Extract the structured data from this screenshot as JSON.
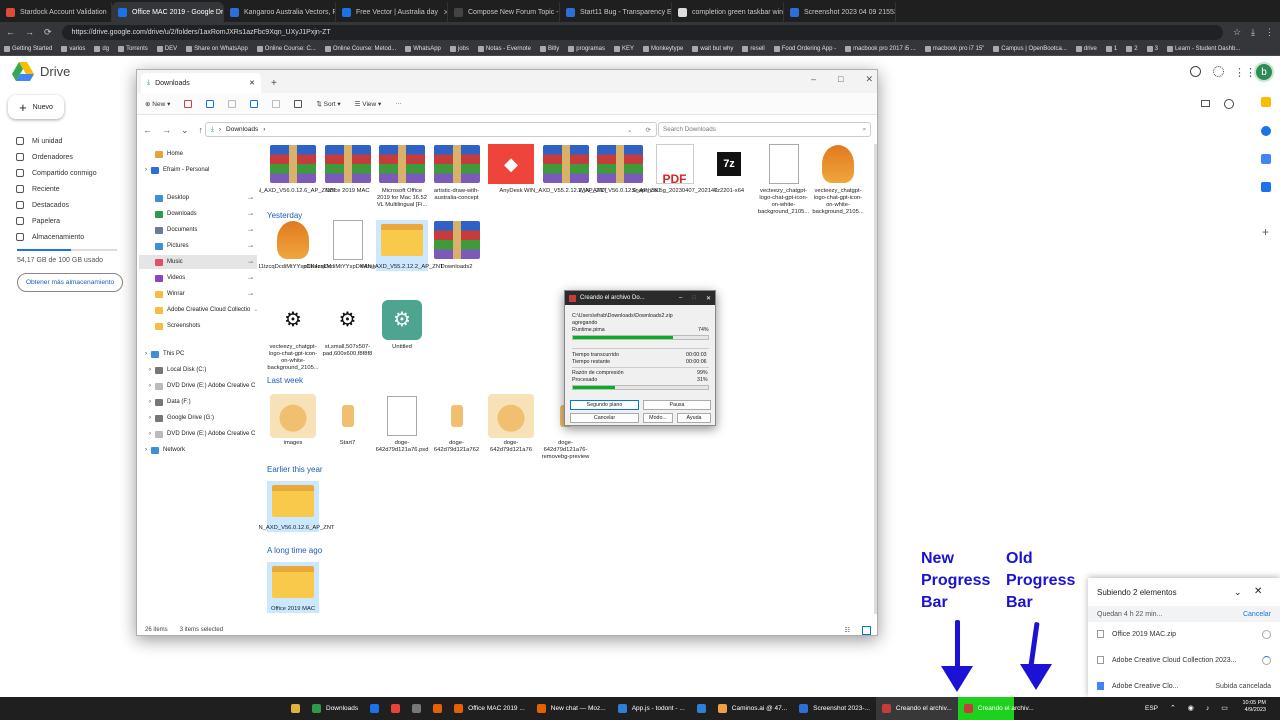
{
  "browser": {
    "tabs": [
      {
        "title": "Stardock Account Validation",
        "color": "#e04a3a"
      },
      {
        "title": "Office MAC 2019 - Google Drive",
        "color": "#1a73e8",
        "active": true
      },
      {
        "title": "Kangaroo Australia Vectors, Ph",
        "color": "#2d6fd8"
      },
      {
        "title": "Free Vector | Australia day",
        "color": "#1a73e8"
      },
      {
        "title": "Compose New Forum Topic -",
        "color": "#444"
      },
      {
        "title": "Start11 Bug - Transparency Eff",
        "color": "#2d6fd8"
      },
      {
        "title": "completion green taskbar wind",
        "color": "#ddd"
      },
      {
        "title": "Screenshot 2023 04 09 215536",
        "color": "#2d6fd8"
      }
    ],
    "url": "https://drive.google.com/drive/u/2/folders/1axRomJXRs1azFbc9Xqn_UXyJ1Pxjn-ZT",
    "bookmarks": [
      "Getting Started",
      "varios",
      "dg",
      "Torrents",
      "DEV",
      "Share on WhatsApp",
      "Online Course: C...",
      "Online Course: Metod...",
      "WhatsApp",
      "jobs",
      "Notas - Evernote",
      "Bitly",
      "programas",
      "KEY",
      "Monkeytype",
      "wait but why",
      "resell",
      "Food Ordering App -",
      "macbook pro 2017 i5 ...",
      "macbook pro i7 15\"",
      "Campus | OpenBootca...",
      "drive",
      "1",
      "2",
      "3",
      "Learn - Student Dashb..."
    ]
  },
  "drive": {
    "logo": "Drive",
    "new_button": "Nuevo",
    "nav": [
      "Mi unidad",
      "Ordenadores",
      "Compartido conmigo",
      "Reciente",
      "Destacados",
      "Papelera",
      "Almacenamiento"
    ],
    "storage_text": "54,17 GB de 100 GB usado",
    "storage_used_fraction": 0.54,
    "get_storage": "Obtener más almacenamiento",
    "avatar": "b"
  },
  "explorer": {
    "tab_title": "Downloads",
    "commands": [
      "New",
      "Sort",
      "View"
    ],
    "breadcrumb": "Downloads",
    "search_placeholder": "Search Downloads",
    "nav": [
      {
        "label": "Home",
        "color": "#e8a33c"
      },
      {
        "label": "Efraim - Personal",
        "color": "#2d6fd8"
      },
      {
        "label": "Desktop",
        "color": "#3d8fd8",
        "pin": true
      },
      {
        "label": "Downloads",
        "color": "#2d9a4a",
        "pin": true
      },
      {
        "label": "Documents",
        "color": "#6c7b95",
        "pin": true
      },
      {
        "label": "Pictures",
        "color": "#3d8fd8",
        "pin": true
      },
      {
        "label": "Music",
        "color": "#e0506b",
        "pin": true,
        "selected": true
      },
      {
        "label": "Videos",
        "color": "#8b45c4",
        "pin": true
      },
      {
        "label": "Winrar",
        "color": "#f0c040",
        "pin": true
      },
      {
        "label": "Adobe Creative Cloud Collectio",
        "color": "#f0c040",
        "pin": true
      },
      {
        "label": "Screenshots",
        "color": "#f0c040"
      },
      {
        "label": "This PC",
        "color": "#3d8fd8"
      },
      {
        "label": "Local Disk (C:)",
        "color": "#777"
      },
      {
        "label": "DVD Drive (E:) Adobe Creative C",
        "color": "#bbb"
      },
      {
        "label": "Data (F:)",
        "color": "#777"
      },
      {
        "label": "Google Drive (G:)",
        "color": "#777"
      },
      {
        "label": "DVD Drive (E:) Adobe Creative C",
        "color": "#bbb"
      },
      {
        "label": "Network",
        "color": "#3d8fd8"
      }
    ],
    "sections": {
      "yesterday": "Yesterday",
      "last_week": "Last week",
      "earlier": "Earlier this year",
      "long_ago": "A long time ago"
    },
    "files_today": [
      {
        "name": "WIN_AXD_V56.0.12.6_AP_ZNZT",
        "kind": "rar"
      },
      {
        "name": "Office 2019 MAC",
        "kind": "rar"
      },
      {
        "name": "Microsoft Office 2019 for Mac 16.52 VL Multilingual [Fi...",
        "kind": "rar"
      },
      {
        "name": "artistic-draw-with-australia-concept",
        "kind": "rar"
      },
      {
        "name": "AnyDesk",
        "kind": "any"
      },
      {
        "name": "WIN_AXD_V55.2.12.2_AP_ZNT",
        "kind": "rar"
      },
      {
        "name": "WIN_AXD_V56.0.12.6_AP_ZNT",
        "kind": "rar"
      },
      {
        "name": "SnapshotLog_20230407_202146",
        "kind": "pdf"
      },
      {
        "name": "7z2201-x64",
        "kind": "exe"
      },
      {
        "name": "vecteezy_chatgpt-logo-chat-gpt-icon-on-white-background_2105...",
        "kind": "doc"
      },
      {
        "name": "vecteezy_chatgpt-logo-chat-gpt-icon-on-white-background_2105...",
        "kind": "chick"
      },
      {
        "name": "o11tzcqDcdiMtYYspDK4zskM",
        "kind": "chick"
      },
      {
        "name": "o11tzcqDcdiMtYYspDK4zskM.avif",
        "kind": "doc"
      },
      {
        "name": "WIN_AXD_V55.2.12.2_AP_ZNT",
        "kind": "fold",
        "selected": true
      },
      {
        "name": "Downloads2",
        "kind": "rar"
      }
    ],
    "files_yesterday": [
      {
        "name": "vecteezy_chatgpt-logo-chat-gpt-icon-on-white-background_2105...",
        "kind": "gptw"
      },
      {
        "name": "st,small,507x507-pad,600x600,f8f8f8",
        "kind": "gptw"
      },
      {
        "name": "Untitled",
        "kind": "gptg"
      }
    ],
    "files_last_week": [
      {
        "name": "images",
        "kind": "dog"
      },
      {
        "name": "Start7",
        "kind": "small"
      },
      {
        "name": "doge-642d79d121a76.psd",
        "kind": "doc"
      },
      {
        "name": "doge-642d79d121a762",
        "kind": "small"
      },
      {
        "name": "doge-642d79d121a76",
        "kind": "dog"
      },
      {
        "name": "doge-642d79d121a76-removebg-preview",
        "kind": "small"
      }
    ],
    "files_earlier": [
      {
        "name": "WIN_AXD_V56.0.12.6_AP_ZNT",
        "kind": "fold",
        "selected": true
      }
    ],
    "files_long_ago": [
      {
        "name": "Office 2019 MAC",
        "kind": "fold",
        "selected": true
      }
    ],
    "status_count": "26 items",
    "status_selected": "3 items selected"
  },
  "winrar": {
    "title": "Creando el archivo Do...",
    "path": "C:\\Users\\efrab\\Downloads\\Downloads2.zip",
    "action": "agregando",
    "current_file": "Runtime.pima",
    "current_pct": "74%",
    "current_fraction": 0.74,
    "elapsed_label": "Tiempo transcurrido",
    "elapsed": "00:00:03",
    "remaining_label": "Tiempo restante",
    "remaining": "00:00:06",
    "ratio_label": "Razón de compresión",
    "ratio": "99%",
    "processed_label": "Procesado",
    "processed": "31%",
    "processed_fraction": 0.31,
    "buttons": [
      "Segundo plano",
      "Pausa",
      "Cancelar",
      "Modo...",
      "Ayuda"
    ]
  },
  "annotations": {
    "new": [
      "New",
      "Progress",
      "Bar"
    ],
    "old": [
      "Old",
      "Progress",
      "Bar"
    ]
  },
  "upload": {
    "title": "Subiendo 2 elementos",
    "eta": "Quedan 4 h 22 min...",
    "cancel": "Cancelar",
    "items": [
      {
        "name": "Office 2019 MAC.zip",
        "status": ""
      },
      {
        "name": "Adobe Creative Cloud Collection 2023...",
        "status": ""
      },
      {
        "name": "Adobe Creative Clo...",
        "status": "Subida cancelada"
      }
    ]
  },
  "taskbar": {
    "items": [
      {
        "label": "",
        "color": "#e0b040"
      },
      {
        "label": "Downloads",
        "color": "#2d9a4a"
      },
      {
        "label": "",
        "color": "#1a73e8"
      },
      {
        "label": "",
        "color": "#ea4335"
      },
      {
        "label": "",
        "color": "#777"
      },
      {
        "label": "",
        "color": "#e66000"
      },
      {
        "label": "Office MAC 2019 ...",
        "color": "#e66000"
      },
      {
        "label": "New chat — Moz...",
        "color": "#e66000"
      },
      {
        "label": "App.js - todont - ...",
        "color": "#2d7fd8"
      },
      {
        "label": "",
        "color": "#2d7fd8"
      },
      {
        "label": "Caminos.ai @ 47...",
        "color": "#f0a040"
      },
      {
        "label": "Screenshot 2023-...",
        "color": "#2d6fd8"
      },
      {
        "label": "Creando el archiv...",
        "color": "#c63c3c",
        "active": true
      },
      {
        "label": "Creando el archiv...",
        "color": "#c63c3c",
        "green": true
      }
    ],
    "lang": "ESP",
    "time": "10:05 PM",
    "date": "4/9/2023"
  }
}
